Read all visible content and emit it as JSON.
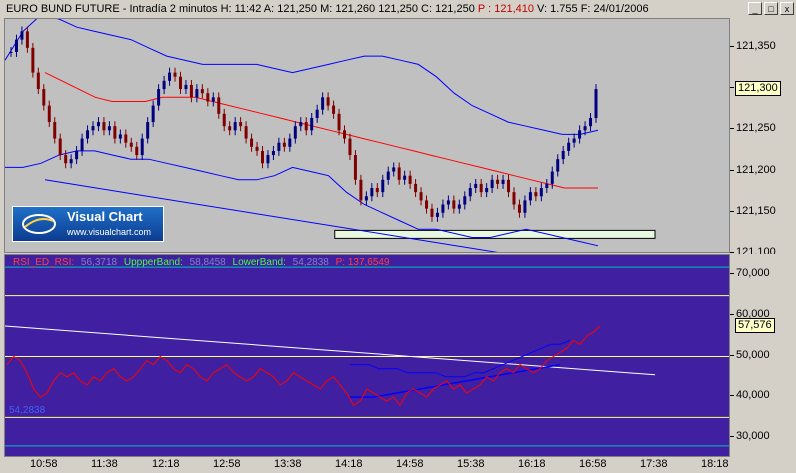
{
  "window": {
    "title_parts": [
      "EURO BUND FUTURE - Intradía 2 minutos",
      "H: 11:42",
      "A: 121,250",
      "M: 121,260",
      "121,250",
      "C: 121,250",
      "P : 121,410",
      "V: 1.755",
      "F: 24/01/2006"
    ],
    "buttons": [
      "_",
      "□",
      "x"
    ]
  },
  "colors": {
    "chart_bg": "#c0c0c0",
    "rsi_bg": "#4020a0",
    "bull_bar": "#000080",
    "bear_bar": "#800000",
    "ma": "#ff0000",
    "bands": "#0000ff",
    "rsi_line": "#ff0000",
    "rsi_bands": "#0000ff",
    "trend_line": "#ffffff",
    "level_lines": "#ffff80",
    "cyan_lines": "#00c0c0"
  },
  "logo": {
    "name": "Visual Chart",
    "url": "www.visualchart.com"
  },
  "rsi_legend": {
    "rsi": "RSI_ED_RSI:",
    "rsi_val": "56,3718",
    "upper": "UppperBand:",
    "upper_val": "58,8458",
    "lower": "LowerBand:",
    "lower_val": "54,2838",
    "p": "P: 137,6549"
  },
  "rsi_side_label": "54,2838",
  "price_current": "121,300",
  "rsi_current": "57,576",
  "chart_data": [
    {
      "type": "candlestick",
      "title": "EURO BUND FUTURE - Intradía 2 minutos",
      "ylim": [
        121.1,
        121.385
      ],
      "y_ticks": [
        "121,350",
        "121,300",
        "121,250",
        "121,200",
        "121,150",
        "121,100"
      ],
      "x_ticks": [
        "10:58",
        "11:38",
        "12:18",
        "12:58",
        "13:38",
        "14:18",
        "14:58",
        "15:38",
        "16:18",
        "16:58",
        "17:38",
        "18:18"
      ],
      "close_series": [
        121.345,
        121.36,
        121.37,
        121.35,
        121.32,
        121.3,
        121.28,
        121.26,
        121.24,
        121.22,
        121.21,
        121.215,
        121.225,
        121.24,
        121.25,
        121.255,
        121.26,
        121.25,
        121.255,
        121.24,
        121.245,
        121.235,
        121.23,
        121.22,
        121.24,
        121.26,
        121.28,
        121.3,
        121.31,
        121.32,
        121.315,
        121.3,
        121.305,
        121.29,
        121.3,
        121.295,
        121.285,
        121.29,
        121.27,
        121.255,
        121.25,
        121.26,
        121.255,
        121.24,
        121.23,
        121.225,
        121.21,
        121.22,
        121.225,
        121.235,
        121.23,
        121.24,
        121.255,
        121.26,
        121.25,
        121.265,
        121.275,
        121.29,
        121.28,
        121.27,
        121.25,
        121.24,
        121.22,
        121.19,
        121.165,
        121.17,
        121.18,
        121.175,
        121.19,
        121.2,
        121.205,
        121.19,
        121.195,
        121.185,
        121.175,
        121.165,
        121.155,
        121.145,
        121.15,
        121.16,
        121.165,
        121.155,
        121.16,
        121.17,
        121.18,
        121.185,
        121.175,
        121.18,
        121.19,
        121.185,
        121.19,
        121.175,
        121.16,
        121.15,
        121.165,
        121.175,
        121.17,
        121.18,
        121.185,
        121.2,
        121.215,
        121.225,
        121.235,
        121.24,
        121.25,
        121.255,
        121.265,
        121.3
      ],
      "ma_series": [
        121.32,
        121.31,
        121.3,
        121.29,
        121.285,
        121.285,
        121.285,
        121.29,
        121.29,
        121.29,
        121.285,
        121.28,
        121.275,
        121.27,
        121.265,
        121.26,
        121.255,
        121.25,
        121.245,
        121.24,
        121.235,
        121.23,
        121.225,
        121.22,
        121.215,
        121.21,
        121.205,
        121.2,
        121.195,
        121.19,
        121.185,
        121.18,
        121.18,
        121.18
      ],
      "upper_band_series": [
        121.335,
        121.37,
        121.39,
        121.385,
        121.375,
        121.37,
        121.365,
        121.36,
        121.35,
        121.34,
        121.335,
        121.33,
        121.33,
        121.33,
        121.33,
        121.325,
        121.32,
        121.325,
        121.33,
        121.335,
        121.34,
        121.34,
        121.335,
        121.33,
        121.315,
        121.295,
        121.28,
        121.27,
        121.26,
        121.255,
        121.25,
        121.245,
        121.245,
        121.25
      ],
      "lower_band_series": [
        121.205,
        121.205,
        121.21,
        121.22,
        121.225,
        121.225,
        121.22,
        121.215,
        121.215,
        121.21,
        121.205,
        121.2,
        121.195,
        121.19,
        121.19,
        121.195,
        121.205,
        121.2,
        121.195,
        121.175,
        121.16,
        121.15,
        121.14,
        121.13,
        121.13,
        121.125,
        121.12,
        121.12,
        121.125,
        121.13,
        121.125,
        121.12,
        121.115,
        121.11
      ],
      "trend_line": {
        "from": [
          "10:58",
          121.19
        ],
        "to": [
          "16:18",
          121.095
        ]
      },
      "support_zone": {
        "from": "14:08",
        "to": "17:38",
        "low": 121.115,
        "high": 121.125
      }
    },
    {
      "type": "line",
      "title": "RSI_ED_RSI",
      "ylim": [
        25,
        75
      ],
      "y_ticks": [
        "70,000",
        "60,000",
        "50,000",
        "40,000",
        "30,000"
      ],
      "series": [
        {
          "name": "RSI_ED_RSI",
          "values": [
            48,
            50,
            49,
            46,
            42,
            40,
            41,
            44,
            46,
            45,
            46,
            44,
            43,
            45,
            44,
            46,
            47,
            45,
            44,
            45,
            47,
            49,
            48,
            50,
            49,
            47,
            46,
            48,
            47,
            45,
            44,
            46,
            47,
            48,
            46,
            45,
            44,
            45,
            47,
            46,
            45,
            43,
            44,
            46,
            45,
            44,
            43,
            42,
            44,
            45,
            43,
            41,
            38,
            39,
            42,
            41,
            40,
            39,
            40,
            38,
            41,
            42,
            41,
            40,
            42,
            43,
            44,
            42,
            43,
            41,
            42,
            43,
            45,
            44,
            46,
            47,
            46,
            48,
            47,
            46,
            47,
            49,
            50,
            51,
            52,
            54,
            53,
            55,
            56,
            57.5
          ]
        },
        {
          "name": "UppperBand",
          "values": [
            48,
            48,
            48,
            47,
            47,
            47,
            46,
            46,
            46,
            46,
            45,
            45,
            45,
            46,
            46,
            47,
            48,
            49,
            50,
            51,
            52,
            53,
            53,
            54
          ]
        },
        {
          "name": "LowerBand",
          "values": [
            40,
            40,
            40,
            40.5,
            41,
            41.5,
            42,
            42.5,
            43,
            43.5,
            44,
            44.5,
            45,
            45.5,
            46,
            46.5,
            47,
            47.5,
            48
          ]
        }
      ],
      "levels": [
        72,
        65,
        50,
        35,
        28
      ],
      "trend_line": {
        "from": [
          "10:58",
          57.5
        ],
        "to": [
          "17:38",
          45.5
        ]
      }
    }
  ]
}
